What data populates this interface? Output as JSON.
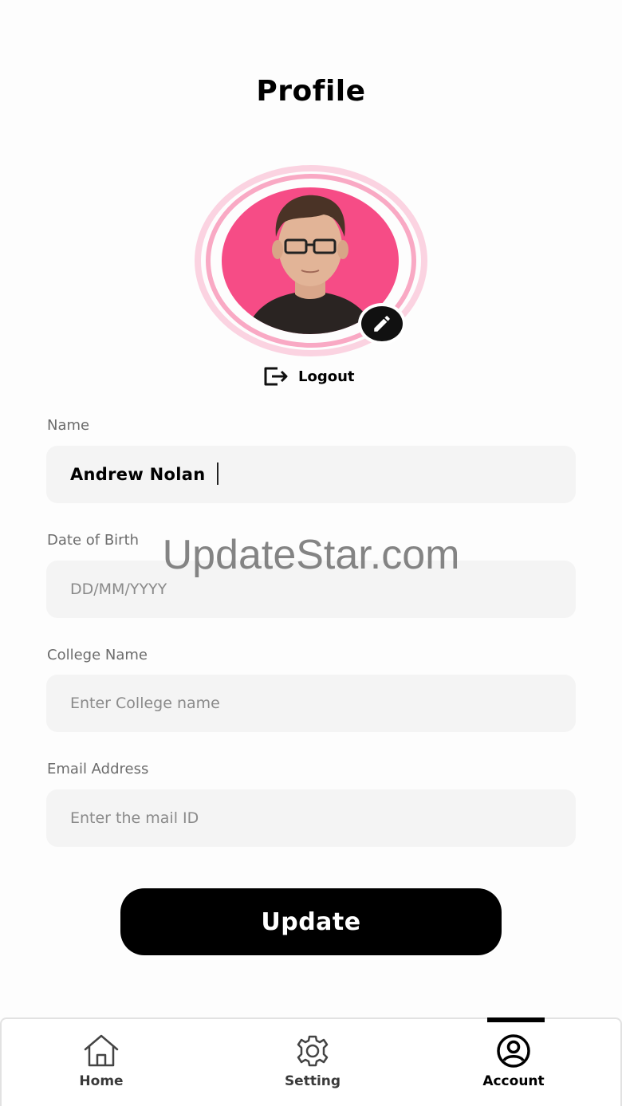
{
  "header": {
    "title": "Profile"
  },
  "profile": {
    "avatar_bg": "#f64c86",
    "edit_icon": "pencil-icon",
    "logout_icon": "logout-icon",
    "logout_label": "Logout"
  },
  "form": {
    "name": {
      "label": "Name",
      "value": "Andrew Nolan",
      "placeholder": ""
    },
    "dob": {
      "label": "Date of Birth",
      "value": "",
      "placeholder": "DD/MM/YYYY"
    },
    "college": {
      "label": "College Name",
      "value": "",
      "placeholder": "Enter College name"
    },
    "email": {
      "label": "Email Address",
      "value": "",
      "placeholder": "Enter the mail ID"
    }
  },
  "watermark": "UpdateStar.com",
  "actions": {
    "update_label": "Update"
  },
  "bottom_nav": {
    "items": [
      {
        "label": "Home",
        "icon": "home-icon",
        "active": false
      },
      {
        "label": "Setting",
        "icon": "gear-icon",
        "active": false
      },
      {
        "label": "Account",
        "icon": "account-icon",
        "active": true
      }
    ]
  },
  "colors": {
    "accent": "#000000",
    "avatar_ring_outer": "#fbd3e1",
    "avatar_ring_inner": "#f9a9c4"
  }
}
